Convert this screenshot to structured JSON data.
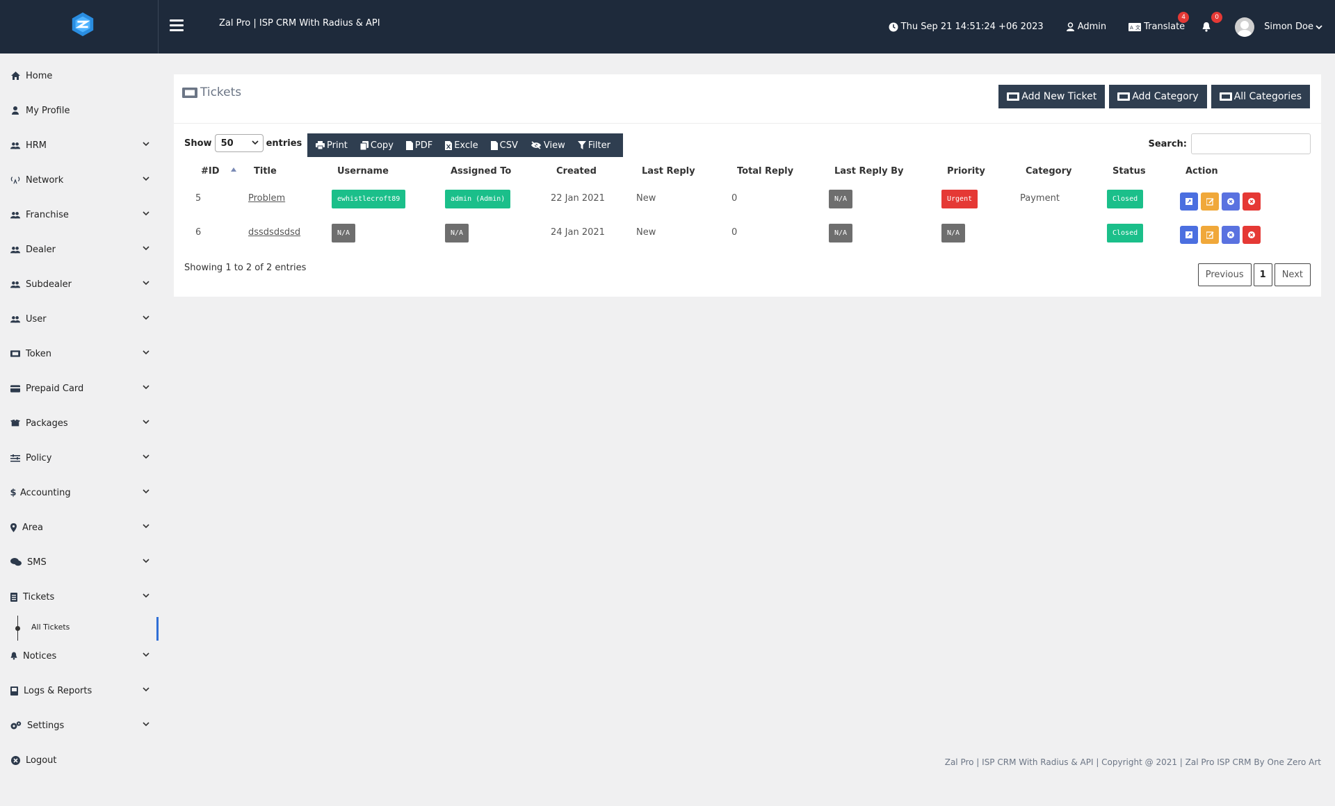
{
  "header": {
    "app_title": "Zal Pro | ISP CRM With Radius & API",
    "datetime": "Thu Sep 21 14:51:24 +06 2023",
    "admin_label": "Admin",
    "translate_label": "Translate",
    "translate_badge": "4",
    "notify_badge": "0",
    "user_name": "Simon Doe"
  },
  "sidebar": {
    "items": [
      {
        "label": "Home"
      },
      {
        "label": "My Profile"
      },
      {
        "label": "HRM"
      },
      {
        "label": "Network"
      },
      {
        "label": "Franchise"
      },
      {
        "label": "Dealer"
      },
      {
        "label": "Subdealer"
      },
      {
        "label": "User"
      },
      {
        "label": "Token"
      },
      {
        "label": "Prepaid Card"
      },
      {
        "label": "Packages"
      },
      {
        "label": "Policy"
      },
      {
        "label": "Accounting"
      },
      {
        "label": "Area"
      },
      {
        "label": "SMS"
      },
      {
        "label": "Tickets"
      },
      {
        "label": "Notices"
      },
      {
        "label": "Logs & Reports"
      },
      {
        "label": "Settings"
      },
      {
        "label": "Logout"
      }
    ],
    "sub_item": "All Tickets"
  },
  "card": {
    "title": "Tickets",
    "buttons": [
      "Add New Ticket",
      "Add Category",
      "All Categories"
    ]
  },
  "table_controls": {
    "show_label": "Show",
    "entries_value": "50",
    "entries_label": "entries",
    "tools": [
      "Print",
      "Copy",
      "PDF",
      "Excle",
      "CSV",
      "View",
      "Filter"
    ],
    "search_label": "Search:"
  },
  "table": {
    "columns": [
      "#ID",
      "Title",
      "Username",
      "Assigned To",
      "Created",
      "Last Reply",
      "Total Reply",
      "Last Reply By",
      "Priority",
      "Category",
      "Status",
      "Action"
    ],
    "rows": [
      {
        "id": "5",
        "title": "Problem",
        "username": "ewhistlecroft89",
        "assigned": "admin (Admin)",
        "created": "22 Jan 2021",
        "last_reply": "New",
        "total_reply": "0",
        "last_reply_by": "N/A",
        "priority": "Urgent",
        "category": "Payment",
        "status": "Closed"
      },
      {
        "id": "6",
        "title": "dssdsdsdsd",
        "username": "N/A",
        "assigned": "N/A",
        "created": "24 Jan 2021",
        "last_reply": "New",
        "total_reply": "0",
        "last_reply_by": "N/A",
        "priority": "N/A",
        "category": "",
        "status": "Closed"
      }
    ]
  },
  "pagination": {
    "showing": "Showing 1 to 2 of 2 entries",
    "previous": "Previous",
    "current": "1",
    "next": "Next"
  },
  "footer": {
    "text": "Zal Pro | ISP CRM With Radius & API | Copyright @ 2021 | Zal Pro ISP CRM By One Zero Art"
  },
  "colors": {
    "header_bg": "#1e2a3b",
    "button_bg": "#2f3e50",
    "tag_green": "#1bbf8a",
    "tag_red": "#e53935",
    "tag_gray": "#6e6e6e"
  }
}
